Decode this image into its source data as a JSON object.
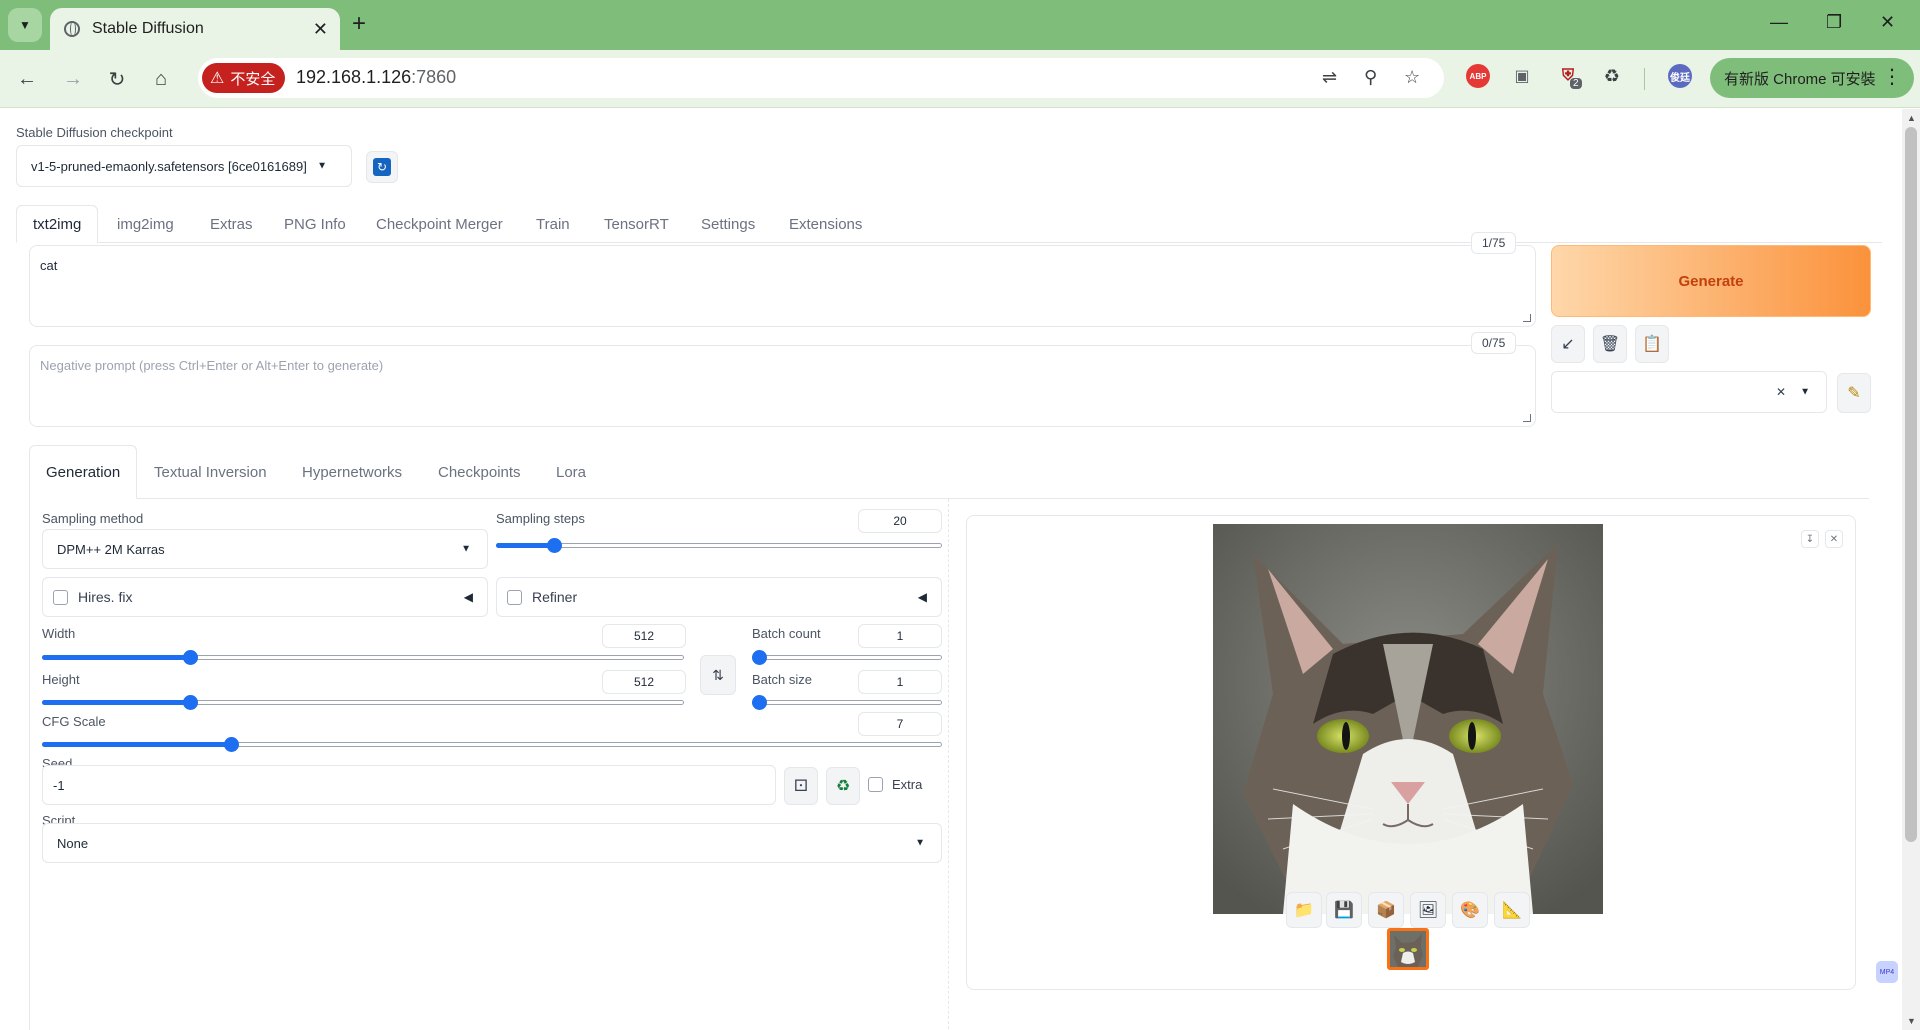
{
  "browser": {
    "tab_title": "Stable Diffusion",
    "security_label": "不安全",
    "url_host": "192.168.1.126",
    "url_port": ":7860",
    "update_label": "有新版 Chrome 可安裝",
    "ext_badge": "2",
    "profile_label": "俊廷",
    "abp_label": "ABP"
  },
  "checkpoint": {
    "label": "Stable Diffusion checkpoint",
    "value": "v1-5-pruned-emaonly.safetensors [6ce0161689]"
  },
  "main_tabs": [
    "txt2img",
    "img2img",
    "Extras",
    "PNG Info",
    "Checkpoint Merger",
    "Train",
    "TensorRT",
    "Settings",
    "Extensions"
  ],
  "prompt": {
    "value": "cat",
    "token_count": "1/75"
  },
  "negative_prompt": {
    "placeholder": "Negative prompt (press Ctrl+Enter or Alt+Enter to generate)",
    "token_count": "0/75"
  },
  "generate_label": "Generate",
  "sub_tabs": [
    "Generation",
    "Textual Inversion",
    "Hypernetworks",
    "Checkpoints",
    "Lora"
  ],
  "generation": {
    "sampling_method_label": "Sampling method",
    "sampling_method_value": "DPM++ 2M Karras",
    "sampling_steps_label": "Sampling steps",
    "sampling_steps_value": "20",
    "hires_label": "Hires. fix",
    "refiner_label": "Refiner",
    "width_label": "Width",
    "width_value": "512",
    "height_label": "Height",
    "height_value": "512",
    "batch_count_label": "Batch count",
    "batch_count_value": "1",
    "batch_size_label": "Batch size",
    "batch_size_value": "1",
    "cfg_label": "CFG Scale",
    "cfg_value": "7",
    "seed_label": "Seed",
    "seed_value": "-1",
    "extra_label": "Extra",
    "script_label": "Script",
    "script_value": "None"
  },
  "sliders": {
    "sampling_steps": 0.13,
    "width": 0.23,
    "height": 0.23,
    "batch_count": 0.0,
    "batch_size": 0.0,
    "cfg": 0.21
  },
  "colors": {
    "accent": "#1d6ef0",
    "generate_start": "#fed7aa",
    "generate_end": "#fb923c"
  }
}
